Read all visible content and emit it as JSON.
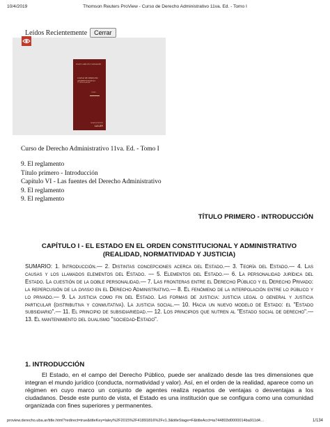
{
  "print_header": {
    "date": "10/4/2019",
    "title": "Thomson Reuters ProView - Curso de Derecho Administrativo 11va. Ed. - Tomo I"
  },
  "recent": {
    "label": "Leídos Recientemente",
    "close_label": "Cerrar"
  },
  "cover": {
    "author": "JUAN CARLOS CASSAGNE",
    "title_line1": "CURSO DE DERECHO",
    "title_line2": "ADMINISTRATIVO",
    "edition": "11ª edición actualizada",
    "volume": "TOMO I",
    "publisher_small": "THOMSON REUTERS",
    "publisher": "LA LEY"
  },
  "breadcrumb": {
    "book_title": "Curso de Derecho Administrativo 11va. Ed. - Tomo I",
    "items": [
      "9. El reglamento",
      "Título primero - Introducción",
      "Capítulo VI - Las fuentes del Derecho Administrativo",
      "9. El reglamento",
      "9. El reglamento"
    ]
  },
  "section_title": "TÍTULO PRIMERO - INTRODUCCIÓN",
  "chapter_title": "CAPÍTULO I - EL ESTADO EN EL ORDEN CONSTITUCIONAL Y ADMINISTRATIVO (REALIDAD, NORMATIVIDAD Y JUSTICIA)",
  "sumario": {
    "label": "SUMARIO: ",
    "s1": "1. Introducción",
    "s2": "2. Distintas concepciones acerca del Estado",
    "s3": "3. Teoría del Estado",
    "s4": "4. Las causas y los llamados elementos del Estado",
    "s5": "5. Elementos del Estado",
    "s6": "6. La personalidad jurídica del Estado. La cuestión de la doble personalidad",
    "s7a": "7. Las fronteras entre el Derecho Público y el Derecho Privado: la repercusión de la ",
    "s7i": "divisio",
    "s7b": " en el Derecho Administrativo",
    "s8": "8. El fenómeno de la interpolación entre lo público y lo privado",
    "s9a": "9. La justicia como fin del Estado. Las formas de justicia: justicia legal o general y justicia particular (distributiva y conmutativa). La justicia social",
    "s10": "10. Hacia un nuevo modelo de Estado: el \"Estado subsidiario\"",
    "s11": "11. El principio de subsidiariedad",
    "s12": "12. Los principios que nutren al \"Estado social de derecho\"",
    "s13": "13. El mantenimiento del dualismo \"sociedad-Estado\"."
  },
  "intro": {
    "heading": "1. INTRODUCCIÓN",
    "paragraph": "El Estado, en el campo del Derecho Público, puede ser analizado desde las tres dimensiones que integran el mundo jurídico (conducta, normatividad y valor). Así, en el orden de la realidad, aparece como un régimen en cuyo marco un conjunto de agentes realiza repartos de ventajas o desventajas a los ciudadanos. Desde este punto de vista, el Estado es una institución que se configura como una comunidad organizada con fines superiores y permanentes."
  },
  "print_footer": {
    "url": "proview.derecho.uba.ar/title.html?redirect=true&titleKey=laley%2F2015%2F41891816%2Fv1.3&titleStage=F&titleAcct=ia744803d0000014ba911d4…",
    "page": "1/134"
  },
  "colors": {
    "badge": "#c0392b",
    "cover": "#6d1717",
    "cover_text": "#e8cfa8"
  }
}
